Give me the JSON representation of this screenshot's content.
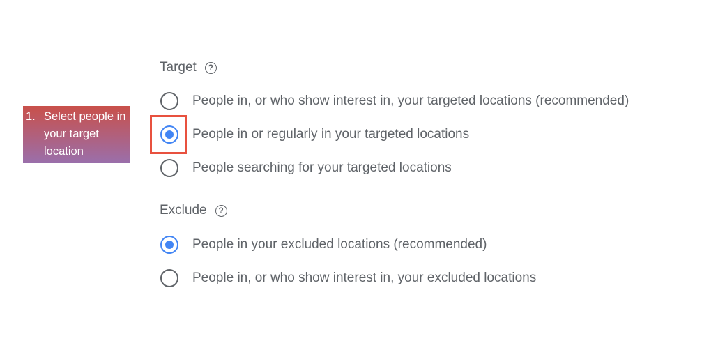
{
  "target": {
    "title": "Target",
    "help_icon": "help-circle-icon",
    "options": [
      {
        "label": "People in, or who show interest in, your targeted locations (recommended)",
        "selected": false
      },
      {
        "label": "People in or regularly in your targeted locations",
        "selected": true
      },
      {
        "label": "People searching for your targeted locations",
        "selected": false
      }
    ]
  },
  "exclude": {
    "title": "Exclude",
    "help_icon": "help-circle-icon",
    "options": [
      {
        "label": "People in your excluded locations (recommended)",
        "selected": true
      },
      {
        "label": "People in, or who show interest in, your excluded locations",
        "selected": false
      }
    ]
  },
  "annotation": {
    "number": "1.",
    "text": "Select people in your target location",
    "highlight_color": "#e8513f"
  },
  "colors": {
    "accent": "#4285f4",
    "text": "#5f6368"
  }
}
